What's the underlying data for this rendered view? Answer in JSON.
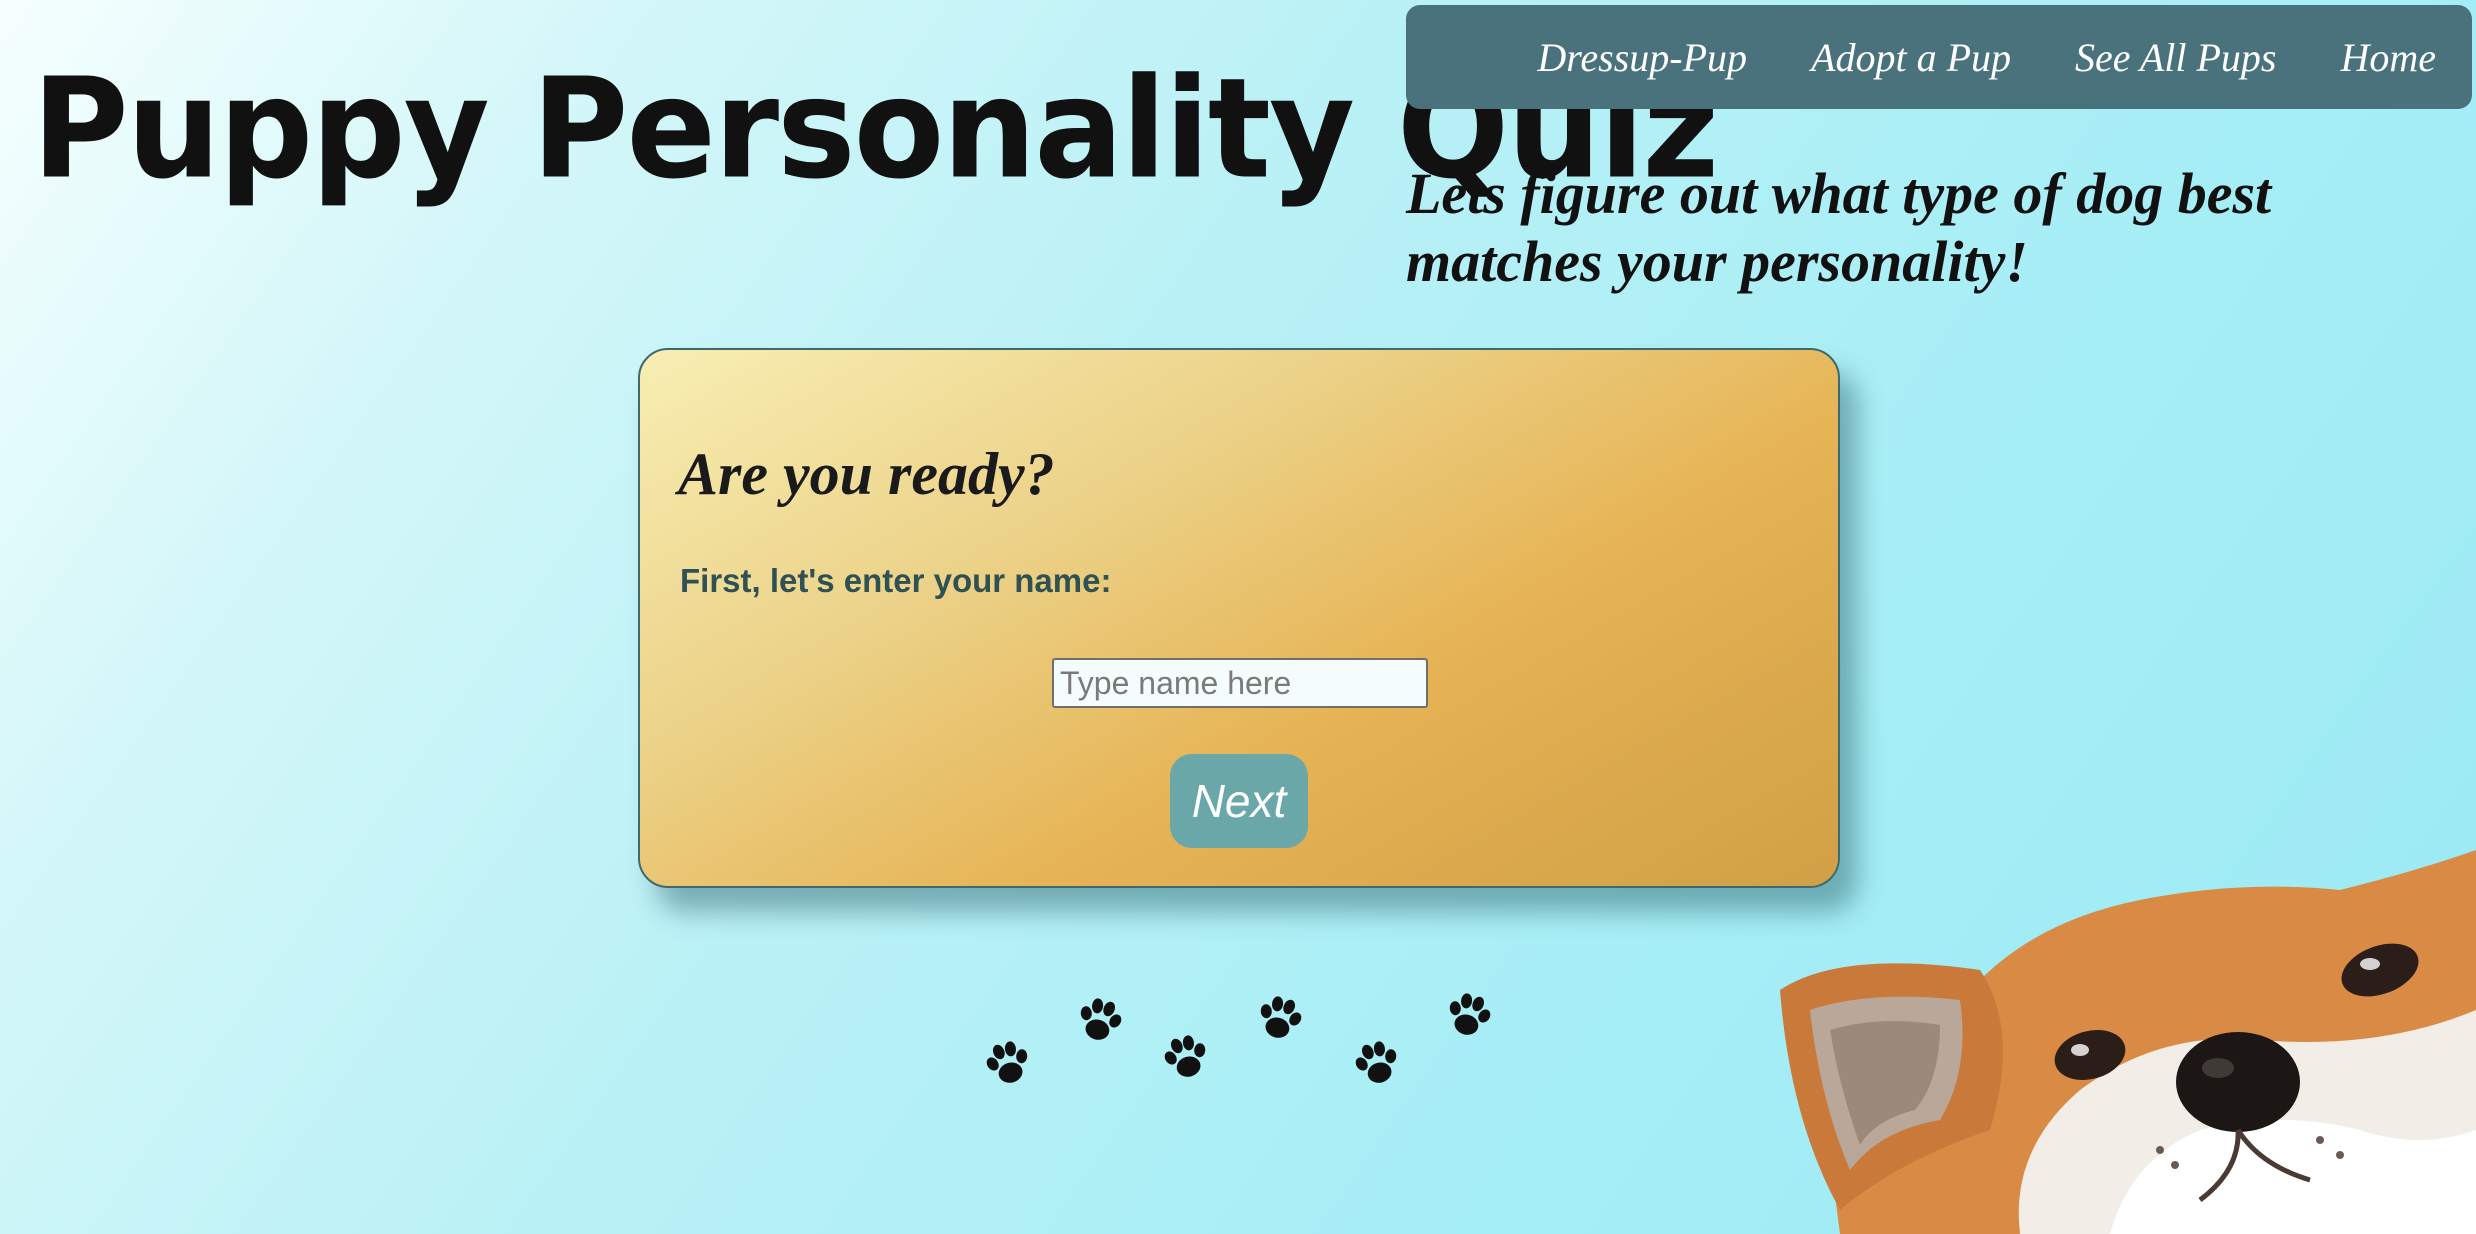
{
  "header": {
    "title": "Puppy Personality Quiz",
    "tagline": "Lets figure out what type of dog best matches your personality!"
  },
  "nav": {
    "items": [
      {
        "label": "Dressup-Pup"
      },
      {
        "label": "Adopt a Pup"
      },
      {
        "label": "See All Pups"
      },
      {
        "label": "Home"
      }
    ]
  },
  "quiz": {
    "heading": "Are you ready?",
    "prompt": "First, let's enter your name:",
    "name_input": {
      "placeholder": "Type name here",
      "value": ""
    },
    "next_label": "Next"
  },
  "decorations": {
    "paw_prints_icon": "paw-print-icon",
    "dog_image": "shiba-inu-peeking-illustration"
  },
  "colors": {
    "nav_background": "#49727d",
    "card_gradient_start": "#f8eeb3",
    "card_gradient_end": "#d19f45",
    "next_button": "#6aa7a8",
    "page_background": "#a6eef6"
  }
}
